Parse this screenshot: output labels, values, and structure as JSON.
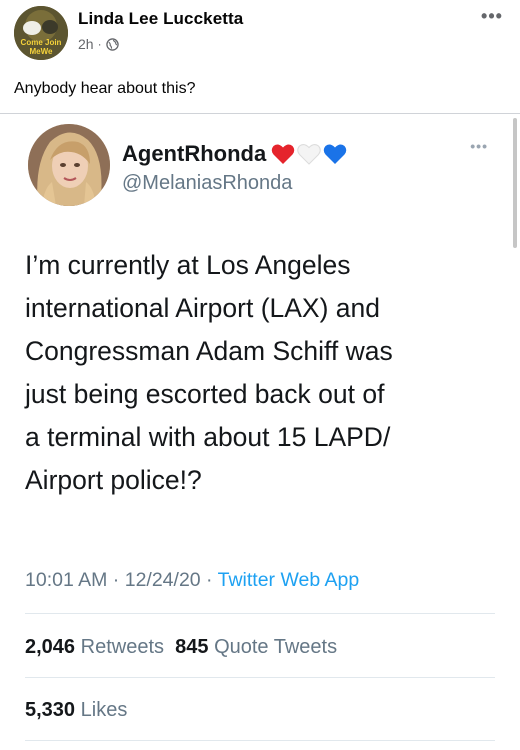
{
  "post": {
    "author": "Linda Lee Luccketta",
    "avatar_text": "Come Join MeWe",
    "time": "2h",
    "separator": "·",
    "audience_icon": "globe-icon",
    "more_icon": "more-horizontal-icon",
    "more_label": "•••",
    "text": "Anybody hear about this?"
  },
  "tweet": {
    "display_name": "AgentRhonda",
    "name_emojis": [
      {
        "icon": "red-heart-icon",
        "color": "#e5242c"
      },
      {
        "icon": "white-heart-icon",
        "color": "#f2f2f2"
      },
      {
        "icon": "blue-heart-icon",
        "color": "#1a73e8"
      }
    ],
    "handle": "@MelaniasRhonda",
    "more_label": "•••",
    "body_lines": [
      "I’m currently at Los Angeles",
      "international Airport (LAX) and",
      "Congressman Adam Schiff was",
      "just being escorted back out of",
      "a terminal with about 15 LAPD/",
      "Airport police!?"
    ],
    "time": "10:01 AM",
    "date": "12/24/20",
    "source": "Twitter Web App",
    "meta_sep": " · ",
    "retweets_count": "2,046",
    "retweets_label": "Retweets",
    "quote_count": "845",
    "quote_label": "Quote Tweets",
    "likes_count": "5,330",
    "likes_label": "Likes"
  },
  "colors": {
    "tweet_link": "#1da1f2",
    "secondary_text": "#657786",
    "fb_secondary": "#65676b"
  }
}
